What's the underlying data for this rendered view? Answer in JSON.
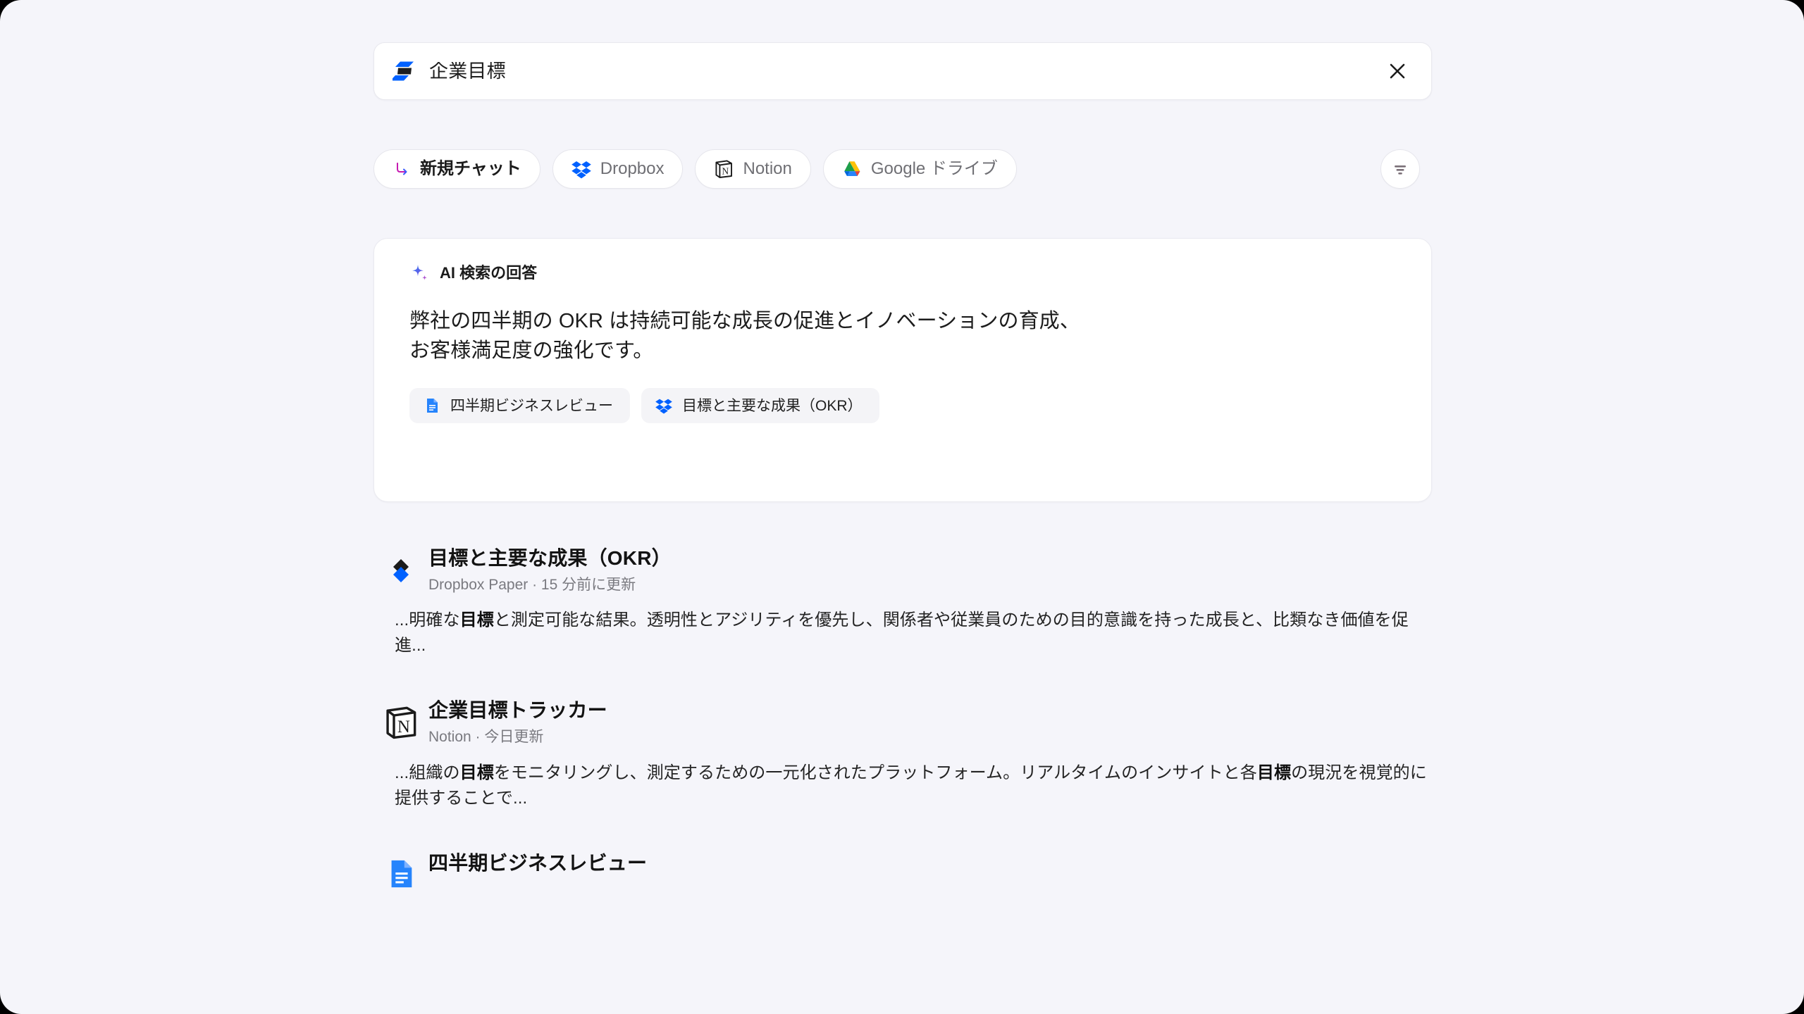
{
  "app": {
    "background_color": "#f5f5fa",
    "card_color": "#ffffff",
    "accent_blue": "#0061ff"
  },
  "search": {
    "value": "企業目標",
    "logo_icon": "dropbox-dash-logo",
    "clear_icon": "close-icon"
  },
  "chips": [
    {
      "label": "新規チャット",
      "icon": "new-chat-arrow-icon",
      "primary": true
    },
    {
      "label": "Dropbox",
      "icon": "dropbox-icon",
      "primary": false
    },
    {
      "label": "Notion",
      "icon": "notion-icon",
      "primary": false
    },
    {
      "label": "Google ドライブ",
      "icon": "google-drive-icon",
      "primary": false
    }
  ],
  "filter_button": {
    "icon": "filter-icon"
  },
  "ai_answer": {
    "header_label": "AI 検索の回答",
    "header_icon": "sparkle-icon",
    "body_line1": "弊社の四半期の OKR は持続可能な成長の促進とイノベーションの育成、",
    "body_line2": "お客様満足度の強化です。",
    "sources": [
      {
        "label": "四半期ビジネスレビュー",
        "icon": "google-docs-icon"
      },
      {
        "label": "目標と主要な成果（OKR）",
        "icon": "dropbox-icon"
      }
    ]
  },
  "results": [
    {
      "title": "目標と主要な成果（OKR）",
      "subtitle": "Dropbox Paper · 15 分前に更新",
      "icon": "dropbox-paper-icon",
      "snippet_parts": [
        {
          "text": "...明確な",
          "bold": false
        },
        {
          "text": "目標",
          "bold": true
        },
        {
          "text": "と測定可能な結果。透明性とアジリティを優先し、関係者や従業員のための目的意識を持った成長と、比類なき価値を促進...",
          "bold": false
        }
      ]
    },
    {
      "title": "企業目標トラッカー",
      "subtitle": "Notion · 今日更新",
      "icon": "notion-icon",
      "snippet_parts": [
        {
          "text": "...組織の",
          "bold": false
        },
        {
          "text": "目標",
          "bold": true
        },
        {
          "text": "をモニタリングし、測定するための一元化されたプラットフォーム。リアルタイムのインサイトと各",
          "bold": false
        },
        {
          "text": "目標",
          "bold": true
        },
        {
          "text": "の現況を視覚的に提供することで...",
          "bold": false
        }
      ]
    },
    {
      "title": "四半期ビジネスレビュー",
      "subtitle": "",
      "icon": "google-docs-icon",
      "snippet_parts": []
    }
  ]
}
